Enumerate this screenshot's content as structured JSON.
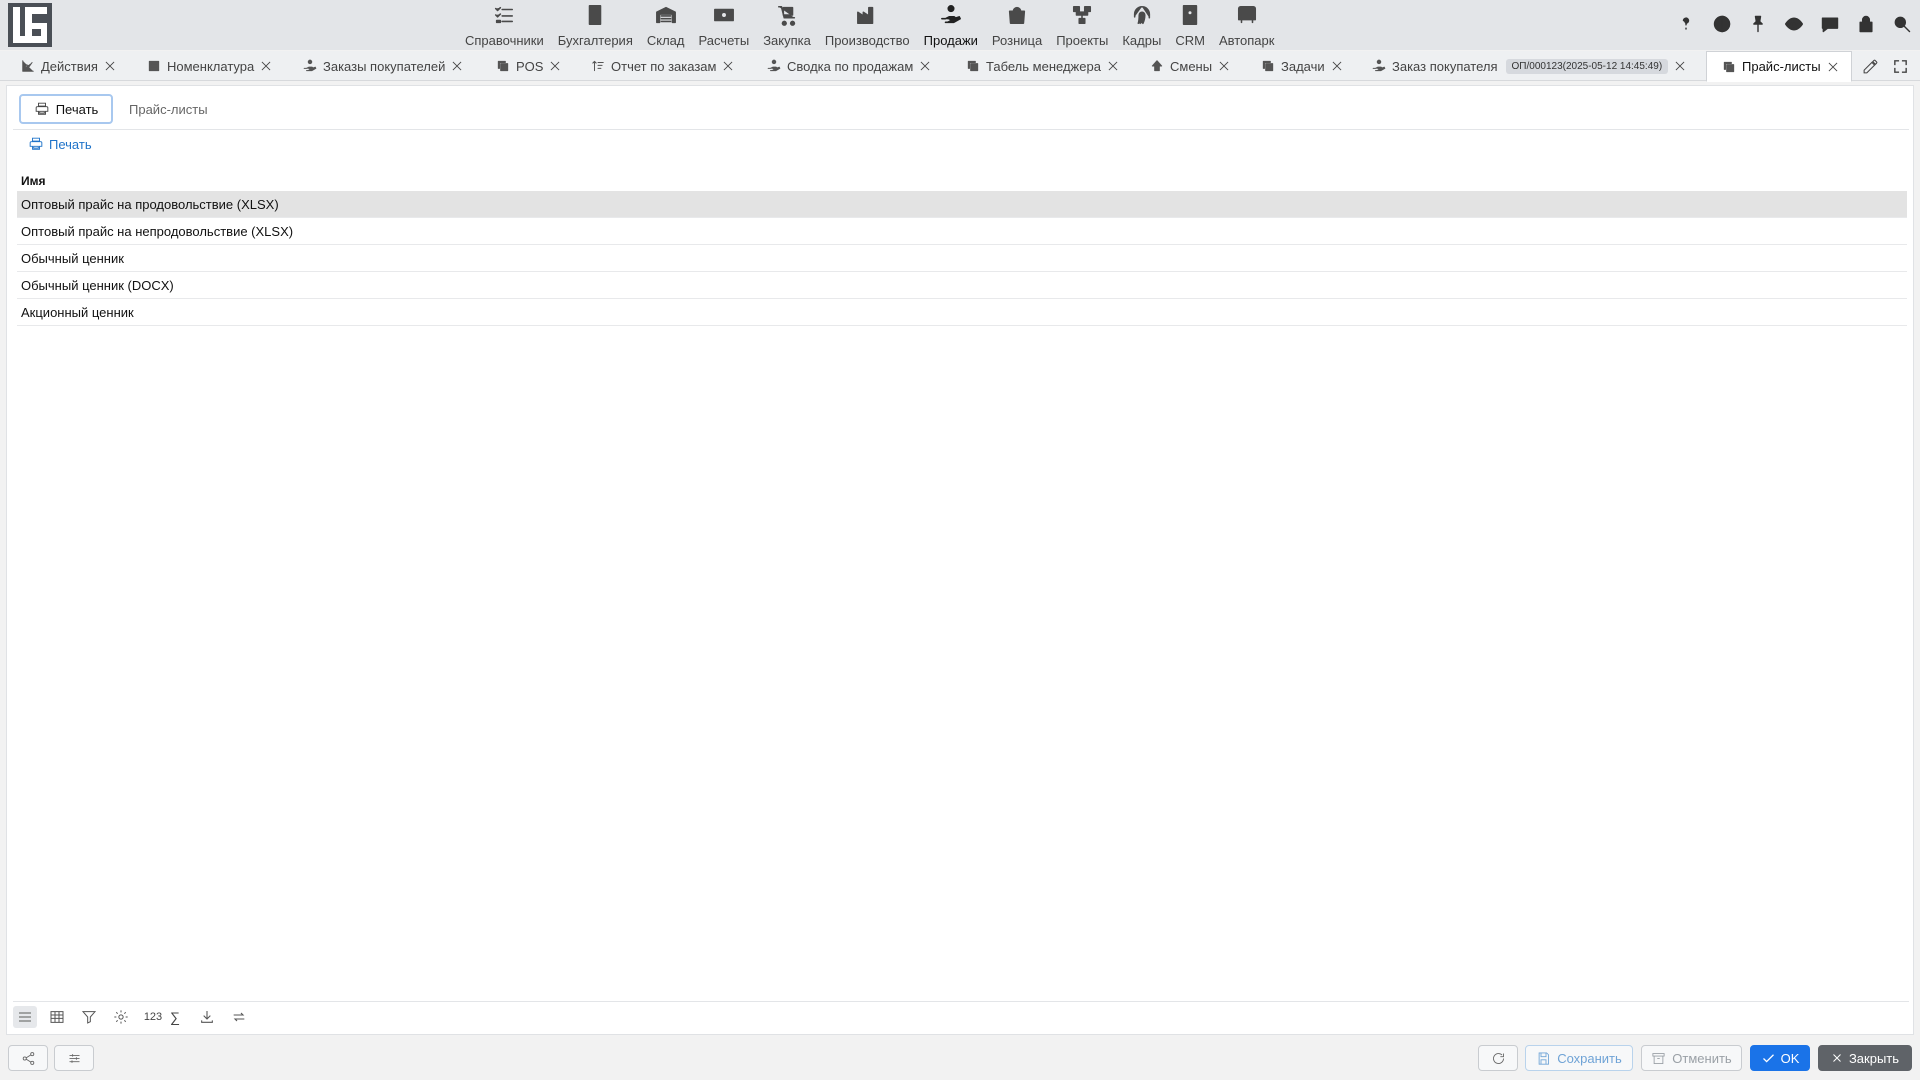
{
  "logo_letters": "LG",
  "modules": [
    {
      "label": "Справочники",
      "icon": "checklist-icon"
    },
    {
      "label": "Бухгалтерия",
      "icon": "ledger-icon"
    },
    {
      "label": "Склад",
      "icon": "warehouse-icon"
    },
    {
      "label": "Расчеты",
      "icon": "banknote-icon"
    },
    {
      "label": "Закупка",
      "icon": "dolly-icon"
    },
    {
      "label": "Производство",
      "icon": "factory-icon"
    },
    {
      "label": "Продажи",
      "icon": "hand-coin-icon",
      "active": true
    },
    {
      "label": "Розница",
      "icon": "shopping-bag-icon"
    },
    {
      "label": "Проекты",
      "icon": "hierarchy-icon"
    },
    {
      "label": "Кадры",
      "icon": "fingerprint-icon"
    },
    {
      "label": "CRM",
      "icon": "contact-card-icon"
    },
    {
      "label": "Автопарк",
      "icon": "bus-icon"
    }
  ],
  "top_tools": [
    "help-icon",
    "contrast-icon",
    "pin-icon",
    "eye-icon",
    "chat-icon",
    "lock-icon",
    "search-icon"
  ],
  "doc_tabs": [
    {
      "label": "Действия",
      "icon": "chart-line-icon"
    },
    {
      "label": "Номенклатура",
      "icon": "catalog-icon"
    },
    {
      "label": "Заказы покупателей",
      "icon": "hand-coin-icon"
    },
    {
      "label": "POS",
      "icon": "copy-icon"
    },
    {
      "label": "Отчет по заказам",
      "icon": "sort-icon"
    },
    {
      "label": "Сводка по продажам",
      "icon": "hand-coin-icon"
    },
    {
      "label": "Табель менеджера",
      "icon": "copy-icon"
    },
    {
      "label": "Смены",
      "icon": "shift-icon"
    },
    {
      "label": "Задачи",
      "icon": "copy-icon"
    },
    {
      "label": "Заказ покупателя",
      "icon": "hand-coin-icon",
      "badge": "ОП/000123(2025-05-12 14:45:49)"
    },
    {
      "label": "Прайс-листы",
      "icon": "copy-icon",
      "active": true
    }
  ],
  "inner_tabs": [
    {
      "label": "Печать",
      "active": true
    },
    {
      "label": "Прайс-листы"
    }
  ],
  "print_action": "Печать",
  "grid": {
    "column": "Имя",
    "rows": [
      "Оптовый прайс на продовольствие (XLSX)",
      "Оптовый прайс на непродовольствие (XLSX)",
      "Обычный ценник",
      "Обычный ценник (DOCX)",
      "Акционный ценник"
    ],
    "selected_row": 0
  },
  "grid_tools": {
    "numbers_label": "123",
    "sum_label": "∑"
  },
  "footer": {
    "save": "Сохранить",
    "cancel": "Отменить",
    "ok": "OK",
    "close": "Закрыть"
  },
  "colors": {
    "accent": "#1a73e8",
    "link": "#1f73c9",
    "topbar": "#e3e5e8"
  }
}
